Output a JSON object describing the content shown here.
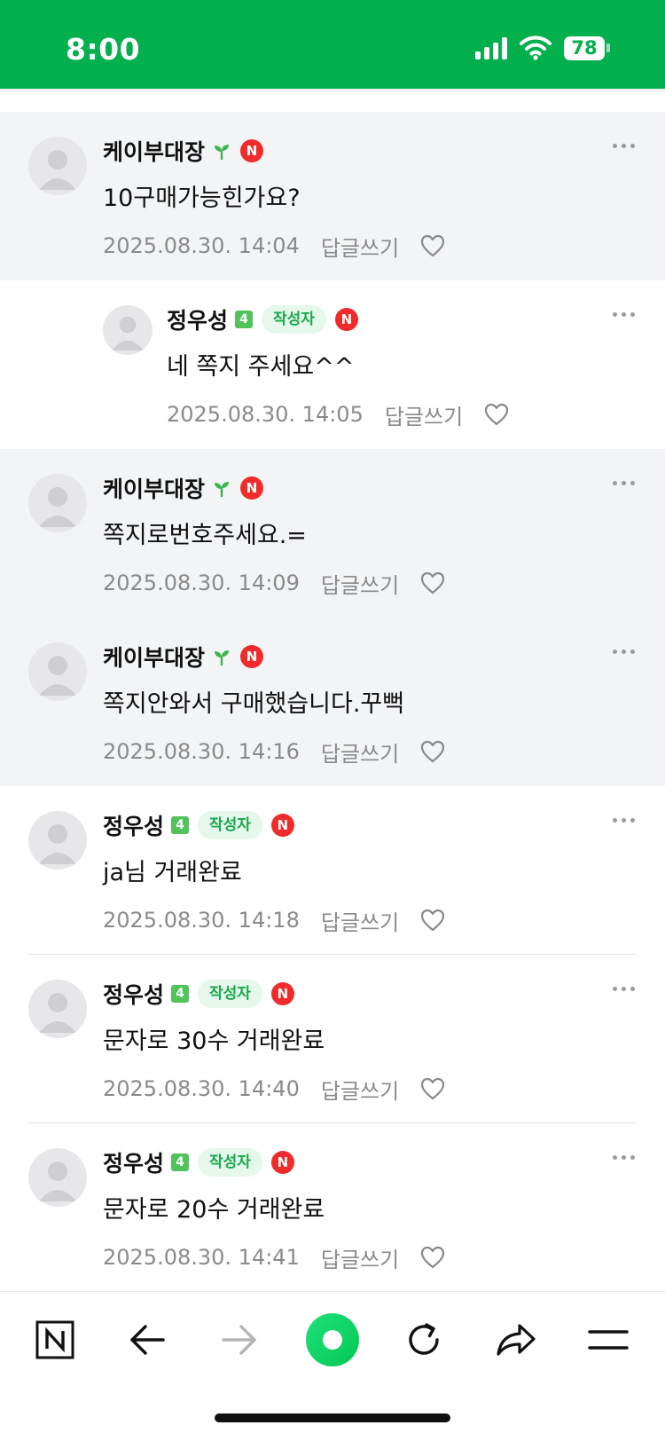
{
  "status_bar": {
    "time": "8:00",
    "battery": "78",
    "accent_color": "#03b04d"
  },
  "comments_gray_1": [
    {
      "nick": "케이부대장",
      "badge": "sprout-icon",
      "n_badge": "N",
      "text": "10구매가능힌가요?",
      "date": "2025.08.30. 14:04",
      "reply_label": "답글쓰기"
    }
  ],
  "reply_1": {
    "nick": "정우성",
    "level": "4",
    "author_label": "작성자",
    "n_badge": "N",
    "text": "네 쪽지 주세요^^",
    "date": "2025.08.30. 14:05",
    "reply_label": "답글쓰기"
  },
  "comments_gray_2": [
    {
      "nick": "케이부대장",
      "n_badge": "N",
      "text": "쪽지로번호주세요.=",
      "date": "2025.08.30. 14:09",
      "reply_label": "답글쓰기"
    },
    {
      "nick": "케이부대장",
      "n_badge": "N",
      "text": "쪽지안와서 구매했습니다.꾸뻑",
      "date": "2025.08.30. 14:16",
      "reply_label": "답글쓰기"
    }
  ],
  "comments_white": [
    {
      "nick": "정우성",
      "level": "4",
      "author_label": "작성자",
      "n_badge": "N",
      "text": "ja님 거래완료",
      "date": "2025.08.30. 14:18",
      "reply_label": "답글쓰기"
    },
    {
      "nick": "정우성",
      "level": "4",
      "author_label": "작성자",
      "n_badge": "N",
      "text": "문자로 30수 거래완료",
      "date": "2025.08.30. 14:40",
      "reply_label": "답글쓰기"
    },
    {
      "nick": "정우성",
      "level": "4",
      "author_label": "작성자",
      "n_badge": "N",
      "text": "문자로 20수 거래완료",
      "date": "2025.08.30. 14:41",
      "reply_label": "답글쓰기"
    }
  ],
  "toolbar": {
    "items": [
      "naver-home-icon",
      "back-arrow-icon",
      "forward-arrow-icon",
      "green-dot-icon",
      "refresh-icon",
      "share-icon",
      "menu-icon"
    ],
    "n_logo_text": "N"
  }
}
